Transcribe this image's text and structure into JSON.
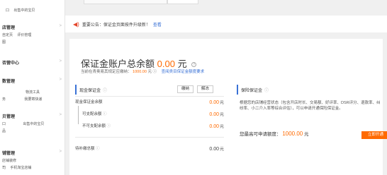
{
  "sidebar": {
    "groups": [
      {
        "title": "",
        "links": [
          "出售中的宝贝"
        ]
      },
      {
        "title": "店管理",
        "links": [
          "自定页",
          "评价管理",
          "图"
        ]
      },
      {
        "title": "否营中心",
        "links": []
      },
      {
        "title": "数管理",
        "links": [
          "物流工具",
          "我要寄快递"
        ]
      },
      {
        "title": "贝管理",
        "links": [
          "出售中的宝贝",
          "品"
        ]
      },
      {
        "title": "铺管理",
        "links": [
          "店铺装修",
          "手机淘宝店铺"
        ]
      }
    ]
  },
  "notice": {
    "icon": "speaker-icon",
    "text": "重要公告：保证金页面按件升级新！",
    "link": "查看"
  },
  "account": {
    "title_prefix": "保证金账户总余额",
    "amount": "0.00",
    "unit": "元",
    "subline_prefix": "当前在青奥易其规定应缴纳：",
    "subline_amount": "1000.00",
    "subline_unit": "元",
    "subline_link": "查阅类目保证金额度要求"
  },
  "cash": {
    "title": "现金保证金",
    "btn_pay": "缴纳",
    "btn_unfreeze": "解冻",
    "rows": [
      {
        "label": "现金保证金余额",
        "value": "0.00",
        "unit": "元"
      },
      {
        "label": "可支配余额",
        "value": "0.00",
        "unit": "元"
      },
      {
        "label": "不可支配余额",
        "value": "0.00",
        "unit": "元"
      },
      {
        "label": "待补缴总额",
        "value": "0.00",
        "unit": "元"
      }
    ]
  },
  "insurance": {
    "title": "保险保证金",
    "desc": "根据您的店铺经营状态（包含开店时长、交易额、好评率、DSR评分、退款率、纠纷率、小二介入率等综合评估），可以申请开通保险保证金。",
    "quota_label": "您最高可申请额度：",
    "quota_value": "1000.00",
    "quota_unit": "元",
    "open_btn": "立即开通"
  },
  "colors": {
    "accent": "#ff6a00",
    "link": "#3a72d6"
  }
}
